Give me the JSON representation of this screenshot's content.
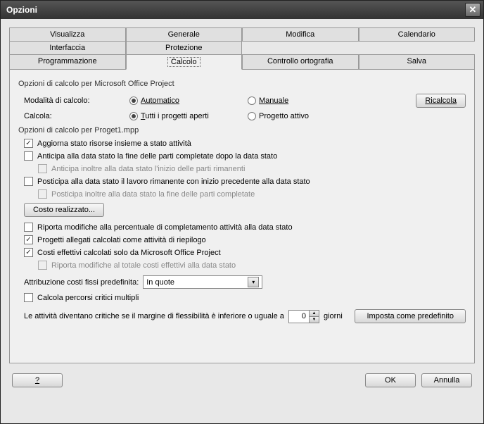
{
  "title": "Opzioni",
  "tabs": {
    "row0": [
      "Visualizza",
      "Generale",
      "Modifica",
      "Calendario"
    ],
    "row1": [
      "Interfaccia",
      "Protezione",
      "",
      ""
    ],
    "row2": [
      "Programmazione",
      "Calcolo",
      "Controllo ortografia",
      "Salva"
    ]
  },
  "group1": {
    "title": "Opzioni di calcolo per Microsoft Office Project",
    "calc_mode_label": "Modalità di calcolo:",
    "calc_mode_auto": "Automatico",
    "calc_mode_manual": "Manuale",
    "calc_mode_value": "auto",
    "calc_label": "Calcola:",
    "calc_all": "Tutti i progetti aperti",
    "calc_active": "Progetto attivo",
    "calc_value": "all",
    "recalc_btn": "Ricalcola"
  },
  "group2": {
    "title": "Opzioni di calcolo per Proget1.mpp",
    "c_update_status": {
      "label": "Aggiorna stato risorse insieme a stato attività",
      "checked": true
    },
    "c_move_startdate": {
      "label": "Anticipa alla data stato la fine delle parti completate dopo la data stato",
      "checked": false
    },
    "c_move_startdate_sub": {
      "label": "Anticipa inoltre alla data stato l'inizio delle parti rimanenti",
      "checked": false,
      "disabled": true
    },
    "c_move_remaining": {
      "label": "Posticipa alla data stato il lavoro rimanente con inizio precedente alla data stato",
      "checked": false
    },
    "c_move_remaining_sub": {
      "label": "Posticipa inoltre alla data stato la fine delle parti completate",
      "checked": false,
      "disabled": true
    },
    "btn_cost": "Costo realizzato...",
    "c_percent": {
      "label": "Riporta modifiche alla percentuale di completamento attività alla data stato",
      "checked": false
    },
    "c_inserted": {
      "label": "Progetti allegati calcolati come attività di riepilogo",
      "checked": true
    },
    "c_actual": {
      "label": "Costi effettivi calcolati solo da Microsoft Office Project",
      "checked": true
    },
    "c_actual_sub": {
      "label": "Riporta modifiche al totale costi effettivi alla data stato",
      "checked": false,
      "disabled": true
    },
    "fixed_label": "Attribuzione costi fissi predefinita:",
    "fixed_value": "In quote",
    "c_multi_critical": {
      "label": "Calcola percorsi critici multipli",
      "checked": false
    },
    "critical_text_a": "Le attività diventano critiche se il margine di flessibilità è inferiore o uguale a",
    "critical_value": "0",
    "critical_text_b": "giorni",
    "btn_default": "Imposta come predefinito"
  },
  "footer": {
    "help": "?",
    "ok": "OK",
    "cancel": "Annulla"
  }
}
